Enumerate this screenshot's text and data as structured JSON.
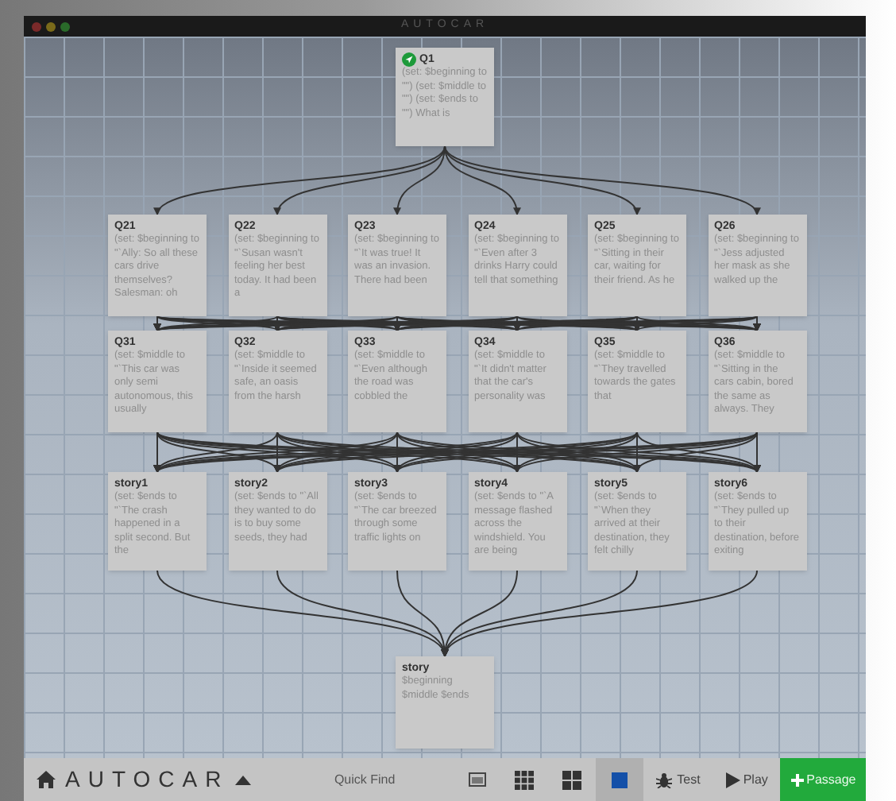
{
  "window": {
    "title": "AUTOCAR"
  },
  "levels": [
    {
      "passages": [
        {
          "name": "Q1",
          "start": true,
          "text": "(set: $beginning to \"\") (set: $middle to \"\") (set: $ends to \"\") What is"
        }
      ]
    },
    {
      "passages": [
        {
          "name": "Q21",
          "start": false,
          "text": "(set: $beginning to \"`Ally: So all these cars drive themselves? Salesman: oh"
        },
        {
          "name": "Q22",
          "start": false,
          "text": "(set: $beginning to \"`Susan wasn't feeling her best today. It had been a"
        },
        {
          "name": "Q23",
          "start": false,
          "text": "(set: $beginning to \"`It was true! It was an invasion. There had been"
        },
        {
          "name": "Q24",
          "start": false,
          "text": "(set: $beginning to \"`Even after 3 drinks Harry could tell that something"
        },
        {
          "name": "Q25",
          "start": false,
          "text": "(set: $beginning to \"`Sitting in their car, waiting for their friend. As he"
        },
        {
          "name": "Q26",
          "start": false,
          "text": "(set: $beginning to \"`Jess adjusted her mask as she walked up the"
        }
      ]
    },
    {
      "passages": [
        {
          "name": "Q31",
          "start": false,
          "text": "(set: $middle to \"`This car was only semi autonomous, this usually"
        },
        {
          "name": "Q32",
          "start": false,
          "text": "(set: $middle to \"`Inside it seemed safe, an oasis from the harsh"
        },
        {
          "name": "Q33",
          "start": false,
          "text": "(set: $middle to \"`Even although the road was cobbled the"
        },
        {
          "name": "Q34",
          "start": false,
          "text": "(set: $middle to \"`It didn't matter that the car's personality was"
        },
        {
          "name": "Q35",
          "start": false,
          "text": "(set: $middle to \"`They travelled towards the gates that"
        },
        {
          "name": "Q36",
          "start": false,
          "text": "(set: $middle to \"`Sitting in the cars cabin, bored the same as always. They"
        }
      ]
    },
    {
      "passages": [
        {
          "name": "story1",
          "start": false,
          "text": "(set: $ends to \"`The crash happened in a split second. But the"
        },
        {
          "name": "story2",
          "start": false,
          "text": "(set: $ends to \"`All they wanted to do is to buy some seeds, they had"
        },
        {
          "name": "story3",
          "start": false,
          "text": "(set: $ends to \"`The car breezed through some traffic lights on"
        },
        {
          "name": "story4",
          "start": false,
          "text": "(set: $ends to \"`A message flashed across the windshield. You are being"
        },
        {
          "name": "story5",
          "start": false,
          "text": "(set: $ends to \"`When they arrived at their destination, they felt chilly"
        },
        {
          "name": "story6",
          "start": false,
          "text": "(set: $ends to \"`They pulled up to their destination, before exiting"
        }
      ]
    },
    {
      "passages": [
        {
          "name": "story",
          "start": false,
          "text": "$beginning $middle $ends"
        }
      ]
    }
  ],
  "toolbar": {
    "story_title": "AUTOCAR",
    "quick_find": "Quick Find",
    "view_buttons": [
      {
        "kind": "titles",
        "selected": false
      },
      {
        "kind": "small",
        "selected": false
      },
      {
        "kind": "medium",
        "selected": false
      },
      {
        "kind": "large",
        "selected": true
      }
    ],
    "test": "Test",
    "play": "Play",
    "add": "Passage"
  }
}
